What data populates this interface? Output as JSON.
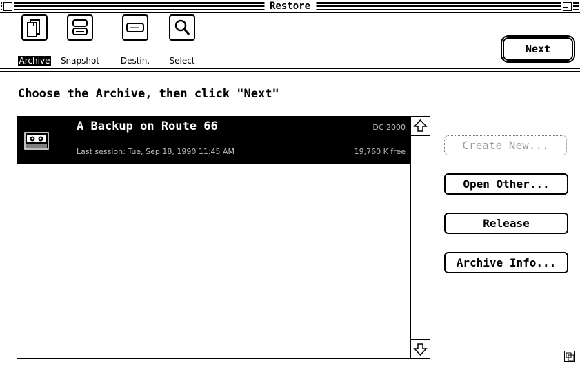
{
  "window": {
    "title": "Restore"
  },
  "toolbar": {
    "tools": [
      {
        "label": "Archive",
        "icon": "archive-icon",
        "selected": true
      },
      {
        "label": "Snapshot",
        "icon": "snapshot-icon",
        "selected": false
      },
      {
        "label": "Destin.",
        "icon": "destination-icon",
        "selected": false
      },
      {
        "label": "Select",
        "icon": "magnifier-icon",
        "selected": false
      }
    ],
    "next_label": "Next"
  },
  "main": {
    "instruction": "Choose the Archive, then click \"Next\"",
    "archives": [
      {
        "name": "A Backup on Route 66",
        "type": "DC 2000",
        "last_session": "Last session:  Tue, Sep 18, 1990  11:45 AM",
        "free": "19,760 K  free",
        "icon": "tape-cartridge-icon",
        "selected": true
      }
    ]
  },
  "actions": {
    "create_new": "Create New...",
    "open_other": "Open Other...",
    "release": "Release",
    "archive_info": "Archive Info..."
  },
  "colors": {
    "foreground": "#000000",
    "background": "#ffffff",
    "selection": "#000000",
    "disabled": "#999999"
  }
}
